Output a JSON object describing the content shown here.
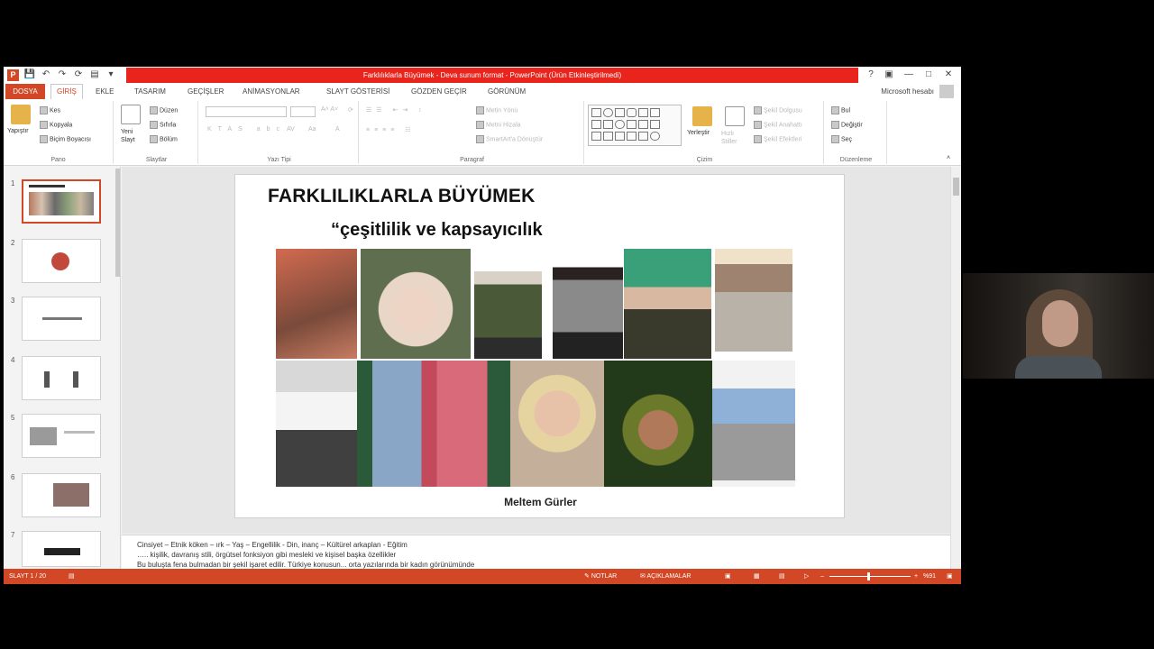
{
  "window": {
    "title": "Farklılıklarla Büyümek - Deva sunum format - PowerPoint (Ürün Etkinleştirilmedi)",
    "app_icon": "P",
    "account": "Microsoft hesabı"
  },
  "tabs": {
    "file": "DOSYA",
    "items": [
      "GİRİŞ",
      "EKLE",
      "TASARIM",
      "GEÇİŞLER",
      "ANİMASYONLAR",
      "SLAYT GÖSTERİSİ",
      "GÖZDEN GEÇİR",
      "GÖRÜNÜM"
    ],
    "active": "GİRİŞ"
  },
  "ribbon": {
    "clipboard": {
      "paste": "Yapıştır",
      "cut": "Kes",
      "copy": "Kopyala",
      "format_painter": "Biçim Boyacısı",
      "group": "Pano"
    },
    "slides": {
      "new_slide": "Yeni Slayt",
      "layout": "Düzen",
      "reset": "Sıfırla",
      "section": "Bölüm",
      "group": "Slaytlar"
    },
    "font": {
      "group": "Yazı Tipi"
    },
    "paragraph": {
      "text_direction": "Metin Yönü",
      "align_text": "Metni Hizala",
      "smartart": "SmartArt'a Dönüştür",
      "group": "Paragraf"
    },
    "drawing": {
      "arrange": "Yerleştir",
      "quick_styles": "Hızlı Stiller",
      "shape_fill": "Şekil Dolgusu",
      "shape_outline": "Şekil Anahattı",
      "shape_effects": "Şekil Efektleri",
      "group": "Çizim"
    },
    "editing": {
      "find": "Bul",
      "replace": "Değiştir",
      "select": "Seç",
      "group": "Düzenleme"
    }
  },
  "thumbnails": [
    "1",
    "2",
    "3",
    "4",
    "5",
    "6",
    "7"
  ],
  "slide": {
    "title": "FARKLILIKLARLA BÜYÜMEK",
    "subtitle": "“çeşitlilik ve kapsayıcılık",
    "author": "Meltem Gürler"
  },
  "notes": {
    "line1": "Cinsiyet – Etnik köken – ırk – Yaş – Engellilik - Din, inanç – Kültürel arkaplan - Eğitim",
    "line2": "….. kişilik, davranış stili, örgütsel fonksiyon gibi mesleki ve kişisel başka özellikler",
    "line3": "Bu buluşta fena bulmadan bir şekil işaret edilir. Türkiye konusun... orta yazılarında bir kadın görünümünde"
  },
  "status": {
    "slide_info": "SLAYT 1 / 20",
    "notes_btn": "NOTLAR",
    "comments_btn": "AÇIKLAMALAR",
    "zoom": "%91"
  },
  "colors": {
    "accent": "#d24726",
    "title_red": "#e8241c"
  }
}
